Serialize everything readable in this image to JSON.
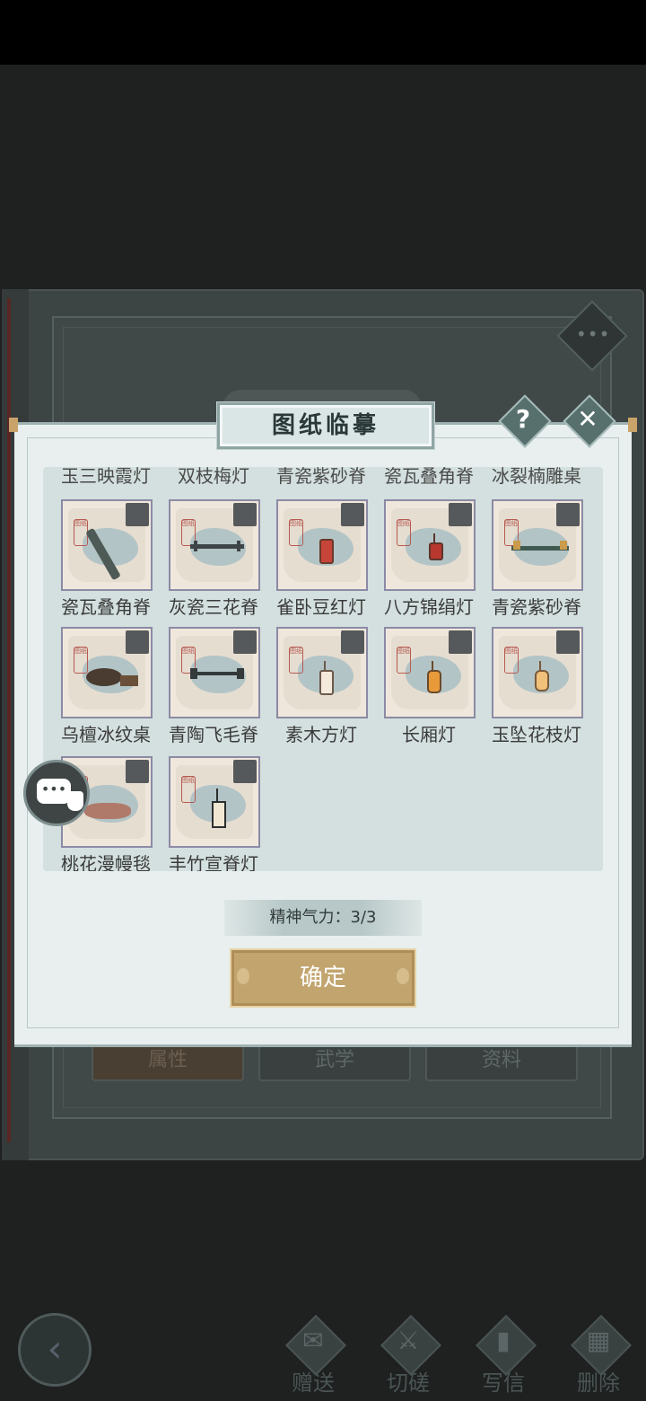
{
  "dialog": {
    "title": "图纸临摹",
    "help_symbol": "?",
    "close_symbol": "✕"
  },
  "partial_row": [
    "玉三映霞灯",
    "双枝梅灯",
    "青瓷紫砂脊",
    "瓷瓦叠角脊",
    "冰裂楠雕桌"
  ],
  "items": [
    {
      "label": "瓷瓦叠角脊",
      "icon": "roof-ridge-icon"
    },
    {
      "label": "灰瓷三花脊",
      "icon": "roof-ridge-icon"
    },
    {
      "label": "雀卧豆红灯",
      "icon": "red-lantern-icon"
    },
    {
      "label": "八方锦绢灯",
      "icon": "red-lantern-icon"
    },
    {
      "label": "青瓷紫砂脊",
      "icon": "roof-ridge-icon"
    },
    {
      "label": "乌檀冰纹桌",
      "icon": "table-icon"
    },
    {
      "label": "青陶飞毛脊",
      "icon": "roof-ridge-icon"
    },
    {
      "label": "素木方灯",
      "icon": "white-lantern-icon"
    },
    {
      "label": "长厢灯",
      "icon": "orange-lantern-icon"
    },
    {
      "label": "玉坠花枝灯",
      "icon": "orange-lantern-icon"
    },
    {
      "label": "桃花漫幔毯",
      "icon": "carpet-icon"
    },
    {
      "label": "丰竹宣脊灯",
      "icon": "hanging-lantern-icon"
    }
  ],
  "stamina_text": "精神气力：3/3",
  "confirm_label": "确定",
  "book_tabs": [
    "属性",
    "武学",
    "资料"
  ],
  "bottom_actions": [
    {
      "label": "赠送",
      "icon": "gift-icon"
    },
    {
      "label": "切磋",
      "icon": "sword-icon"
    },
    {
      "label": "写信",
      "icon": "letter-icon"
    },
    {
      "label": "删除",
      "icon": "trash-icon"
    }
  ],
  "colors": {
    "dialog_bg": "#e8efee",
    "title_plate": "#d9e6e5",
    "confirm_gold": "#c2a46e",
    "background": "#1f2020"
  }
}
